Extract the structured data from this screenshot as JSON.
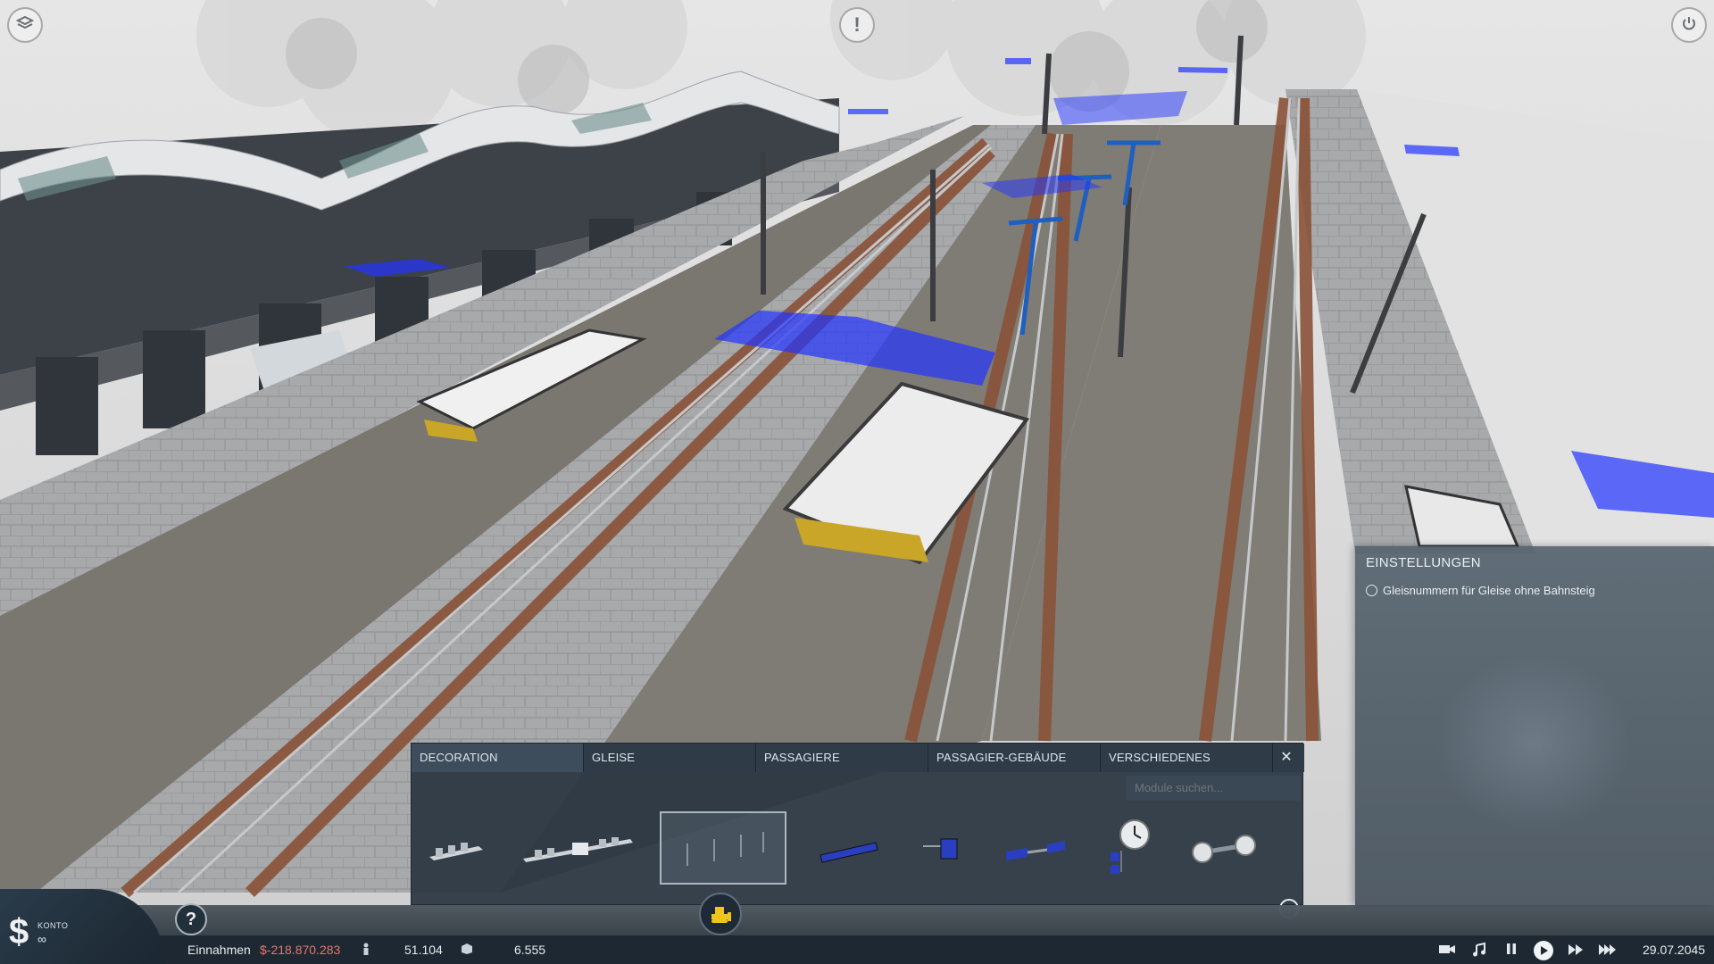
{
  "top_controls": {
    "layers_icon": "layers-icon",
    "alert_icon": "alert-icon",
    "alert_glyph": "!",
    "power_icon": "power-icon"
  },
  "settings_panel": {
    "title": "EINSTELLUNGEN",
    "options": [
      {
        "label": "Gleisnummern für Gleise ohne Bahnsteig",
        "checked": false
      }
    ]
  },
  "build_menu": {
    "tabs": [
      {
        "label": "DECORATION",
        "active": true
      },
      {
        "label": "GLEISE",
        "active": false
      },
      {
        "label": "PASSAGIERE",
        "active": false
      },
      {
        "label": "PASSAGIER-GEBÄUDE",
        "active": false
      },
      {
        "label": "VERSCHIEDENES",
        "active": false
      }
    ],
    "close_glyph": "✕",
    "search_placeholder": "Module suchen...",
    "modules": [
      {
        "name": "bench-module",
        "selected": false
      },
      {
        "name": "bench-row-module",
        "selected": false
      },
      {
        "name": "lamp-posts-module",
        "selected": true
      },
      {
        "name": "platform-sign-module",
        "selected": false
      },
      {
        "name": "small-sign-module",
        "selected": false
      },
      {
        "name": "hanging-sign-module",
        "selected": false
      },
      {
        "name": "clock-sign-module",
        "selected": false
      },
      {
        "name": "double-clock-module",
        "selected": false
      }
    ],
    "next_glyph": "›"
  },
  "bottom_bar": {
    "konto_label": "KONTO",
    "konto_value": "∞",
    "dollar_glyph": "$",
    "help_glyph": "?",
    "income_label": "Einnahmen",
    "income_value": "$-218.870.283",
    "passengers_value": "51.104",
    "cargo_value": "6.555",
    "date": "29.07.2045",
    "colors": {
      "income_negative": "#e8776a",
      "accent_blue": "#2233ff"
    }
  }
}
